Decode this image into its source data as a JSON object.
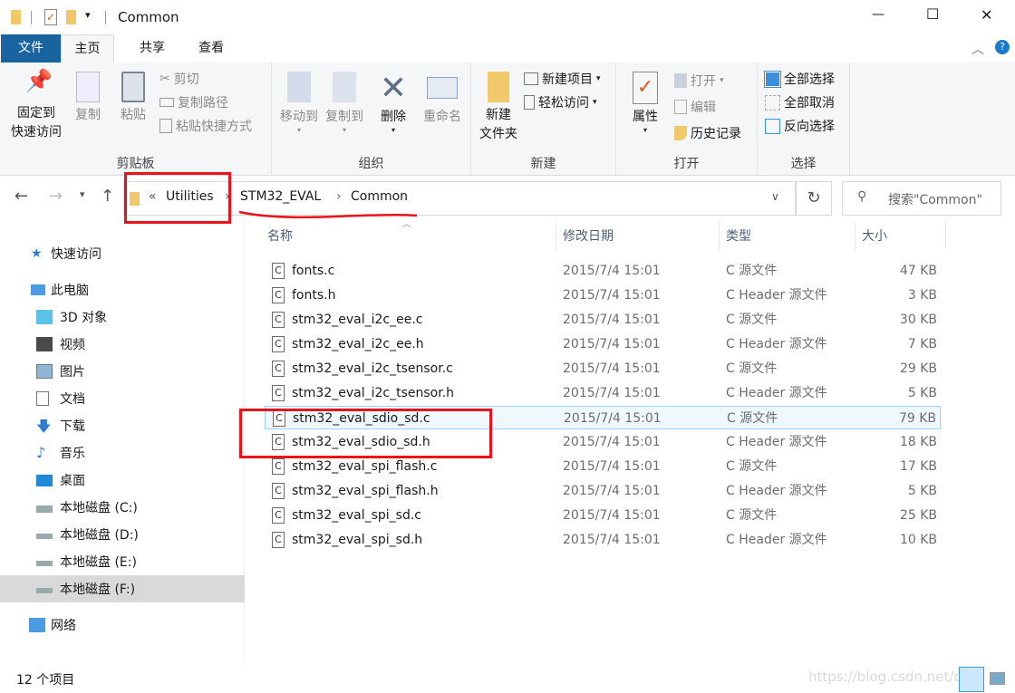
{
  "window": {
    "title": "Common",
    "minimize": "—",
    "maximize": "☐",
    "close": "✕"
  },
  "tabs": [
    {
      "label": "文件"
    },
    {
      "label": "主页"
    },
    {
      "label": "共享"
    },
    {
      "label": "查看"
    }
  ],
  "ribbon": {
    "clipboard": {
      "label": "剪贴板",
      "pin": "固定到",
      "pin2": "快速访问",
      "copy": "复制",
      "paste": "粘贴",
      "cut": "剪切",
      "copy_path": "复制路径",
      "paste_shortcut": "粘贴快捷方式"
    },
    "organize": {
      "label": "组织",
      "move_to": "移动到",
      "copy_to": "复制到",
      "delete": "删除",
      "rename": "重命名"
    },
    "new": {
      "label": "新建",
      "new_folder": "新建",
      "new_folder2": "文件夹",
      "new_item": "新建项目",
      "easy_access": "轻松访问"
    },
    "open": {
      "label": "打开",
      "properties": "属性",
      "open": "打开",
      "edit": "编辑",
      "history": "历史记录"
    },
    "select": {
      "label": "选择",
      "select_all": "全部选择",
      "select_none": "全部取消",
      "invert": "反向选择"
    }
  },
  "address": {
    "overflow": "«",
    "crumbs": [
      "Utilities",
      "STM32_EVAL",
      "Common"
    ],
    "search_placeholder": "搜索\"Common\""
  },
  "nav": [
    {
      "label": "快速访问",
      "icon": "star-icon"
    },
    {
      "label": "此电脑",
      "icon": "computer-icon"
    },
    {
      "label": "3D 对象",
      "icon": "cube-icon"
    },
    {
      "label": "视频",
      "icon": "video-icon"
    },
    {
      "label": "图片",
      "icon": "picture-icon"
    },
    {
      "label": "文档",
      "icon": "document-icon"
    },
    {
      "label": "下载",
      "icon": "download-icon"
    },
    {
      "label": "音乐",
      "icon": "music-icon"
    },
    {
      "label": "桌面",
      "icon": "desktop-icon"
    },
    {
      "label": "本地磁盘 (C:)",
      "icon": "drive-icon"
    },
    {
      "label": "本地磁盘 (D:)",
      "icon": "drive-icon"
    },
    {
      "label": "本地磁盘 (E:)",
      "icon": "drive-icon"
    },
    {
      "label": "本地磁盘 (F:)",
      "icon": "drive-icon",
      "selected": true
    },
    {
      "label": "网络",
      "icon": "network-icon"
    }
  ],
  "columns": {
    "name": "名称",
    "date": "修改日期",
    "type": "类型",
    "size": "大小"
  },
  "files": [
    {
      "name": "fonts.c",
      "date": "2015/7/4 15:01",
      "type": "C 源文件",
      "size": "47 KB"
    },
    {
      "name": "fonts.h",
      "date": "2015/7/4 15:01",
      "type": "C Header 源文件",
      "size": "3 KB"
    },
    {
      "name": "stm32_eval_i2c_ee.c",
      "date": "2015/7/4 15:01",
      "type": "C 源文件",
      "size": "30 KB"
    },
    {
      "name": "stm32_eval_i2c_ee.h",
      "date": "2015/7/4 15:01",
      "type": "C Header 源文件",
      "size": "7 KB"
    },
    {
      "name": "stm32_eval_i2c_tsensor.c",
      "date": "2015/7/4 15:01",
      "type": "C 源文件",
      "size": "29 KB"
    },
    {
      "name": "stm32_eval_i2c_tsensor.h",
      "date": "2015/7/4 15:01",
      "type": "C Header 源文件",
      "size": "5 KB"
    },
    {
      "name": "stm32_eval_sdio_sd.c",
      "date": "2015/7/4 15:01",
      "type": "C 源文件",
      "size": "79 KB"
    },
    {
      "name": "stm32_eval_sdio_sd.h",
      "date": "2015/7/4 15:01",
      "type": "C Header 源文件",
      "size": "18 KB"
    },
    {
      "name": "stm32_eval_spi_flash.c",
      "date": "2015/7/4 15:01",
      "type": "C 源文件",
      "size": "17 KB"
    },
    {
      "name": "stm32_eval_spi_flash.h",
      "date": "2015/7/4 15:01",
      "type": "C Header 源文件",
      "size": "5 KB"
    },
    {
      "name": "stm32_eval_spi_sd.c",
      "date": "2015/7/4 15:01",
      "type": "C 源文件",
      "size": "25 KB"
    },
    {
      "name": "stm32_eval_spi_sd.h",
      "date": "2015/7/4 15:01",
      "type": "C Header 源文件",
      "size": "10 KB"
    }
  ],
  "file_icon_letter": "C",
  "status": {
    "count": "12 个项目"
  },
  "watermark": "https://blog.csdn.net/din",
  "colors": {
    "accent": "#1979ca",
    "file_tab": "#19649e",
    "annotation": "#e8141c"
  }
}
